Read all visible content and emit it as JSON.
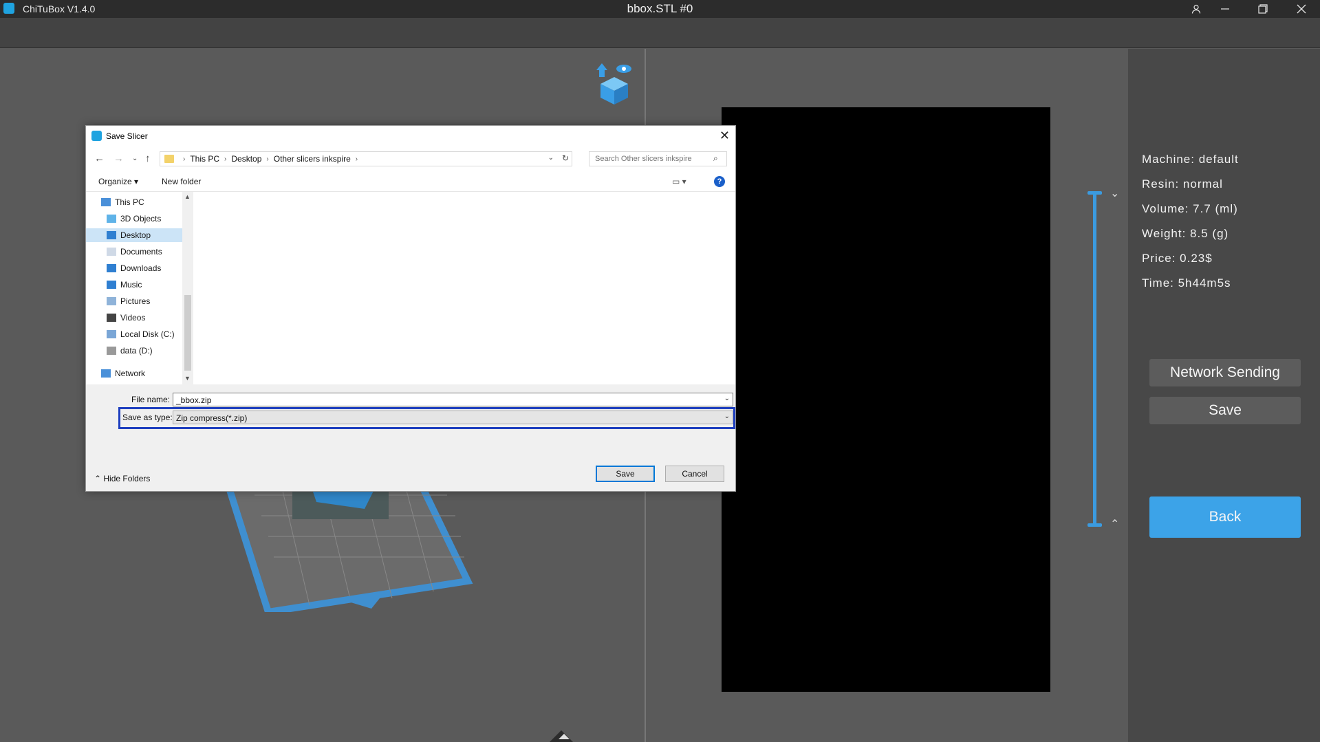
{
  "titlebar": {
    "app_name": "ChiTuBox V1.4.0",
    "file_title": "bbox.STL #0",
    "icons": [
      "user-icon",
      "minimize-icon",
      "restore-icon",
      "close-icon"
    ]
  },
  "info": {
    "machine": "Machine:  default",
    "resin": "Resin:  normal",
    "volume": "Volume:  7.7  (ml)",
    "weight": "Weight:  8.5  (g)",
    "price": "Price:  0.23$",
    "time": "Time:  5h44m5s"
  },
  "panel": {
    "network_sending": "Network Sending",
    "save": "Save",
    "back": "Back"
  },
  "colors": {
    "accent": "#3ca3e8",
    "dialog_highlight": "#1e3fbf"
  },
  "dialog": {
    "title": "Save Slicer",
    "breadcrumb": [
      "This PC",
      "Desktop",
      "Other slicers inkspire"
    ],
    "search_placeholder": "Search Other slicers inkspire",
    "organize": "Organize",
    "new_folder": "New folder",
    "help": "?",
    "nav_items": [
      {
        "label": "This PC",
        "icon": "pc-icon"
      },
      {
        "label": "3D Objects",
        "icon": "3d-objects-icon"
      },
      {
        "label": "Desktop",
        "icon": "desktop-icon",
        "selected": true
      },
      {
        "label": "Documents",
        "icon": "documents-icon"
      },
      {
        "label": "Downloads",
        "icon": "downloads-icon"
      },
      {
        "label": "Music",
        "icon": "music-icon"
      },
      {
        "label": "Pictures",
        "icon": "pictures-icon"
      },
      {
        "label": "Videos",
        "icon": "videos-icon"
      },
      {
        "label": "Local Disk (C:)",
        "icon": "disk-icon"
      },
      {
        "label": "data (D:)",
        "icon": "disk-icon"
      },
      {
        "label": "Network",
        "icon": "network-icon"
      }
    ],
    "file_name_label": "File name:",
    "file_name_value": "_bbox.zip",
    "save_type_label": "Save as type:",
    "save_type_value": "Zip compress(*.zip)",
    "save_button": "Save",
    "cancel_button": "Cancel",
    "hide_folders": "Hide Folders"
  }
}
